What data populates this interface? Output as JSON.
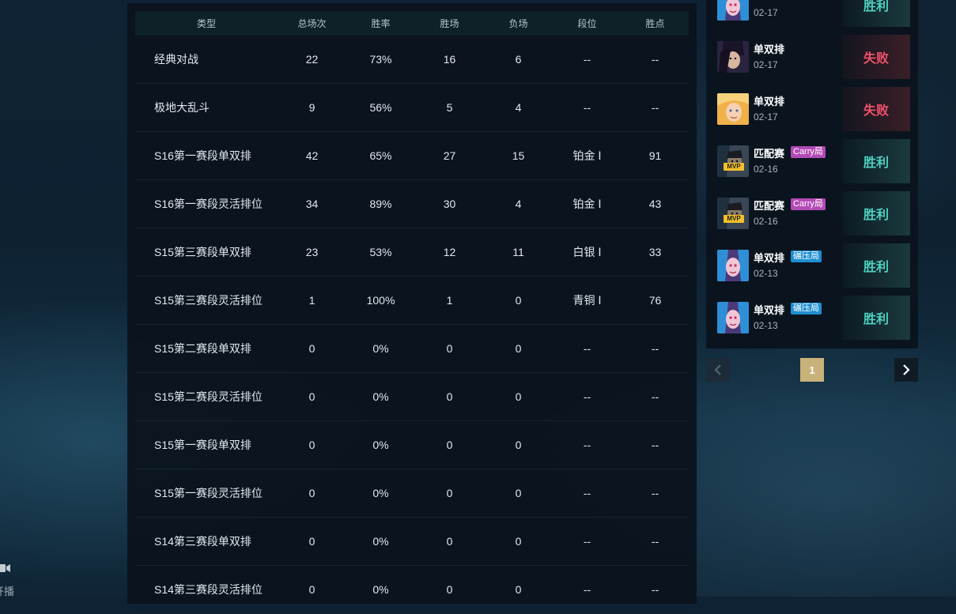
{
  "stats_table": {
    "headers": [
      "类型",
      "总场次",
      "胜率",
      "胜场",
      "负场",
      "段位",
      "胜点"
    ],
    "rows": [
      [
        "经典对战",
        "22",
        "73%",
        "16",
        "6",
        "--",
        "--"
      ],
      [
        "极地大乱斗",
        "9",
        "56%",
        "5",
        "4",
        "--",
        "--"
      ],
      [
        "S16第一赛段单双排",
        "42",
        "65%",
        "27",
        "15",
        "铂金 Ⅰ",
        "91"
      ],
      [
        "S16第一赛段灵活排位",
        "34",
        "89%",
        "30",
        "4",
        "铂金 Ⅰ",
        "43"
      ],
      [
        "S15第三赛段单双排",
        "23",
        "53%",
        "12",
        "11",
        "白银 Ⅰ",
        "33"
      ],
      [
        "S15第三赛段灵活排位",
        "1",
        "100%",
        "1",
        "0",
        "青铜 Ⅰ",
        "76"
      ],
      [
        "S15第二赛段单双排",
        "0",
        "0%",
        "0",
        "0",
        "--",
        "--"
      ],
      [
        "S15第二赛段灵活排位",
        "0",
        "0%",
        "0",
        "0",
        "--",
        "--"
      ],
      [
        "S15第一赛段单双排",
        "0",
        "0%",
        "0",
        "0",
        "--",
        "--"
      ],
      [
        "S15第一赛段灵活排位",
        "0",
        "0%",
        "0",
        "0",
        "--",
        "--"
      ],
      [
        "S14第三赛段单双排",
        "0",
        "0%",
        "0",
        "0",
        "--",
        "--"
      ],
      [
        "S14第三赛段灵活排位",
        "0",
        "0%",
        "0",
        "0",
        "--",
        "--"
      ]
    ]
  },
  "matches": [
    {
      "mode": "",
      "date": "02-17",
      "tag": "",
      "tag_type": "",
      "result": "胜利",
      "result_type": "win",
      "mvp": false,
      "champ": "jinx",
      "partial": true
    },
    {
      "mode": "单双排",
      "date": "02-17",
      "tag": "",
      "tag_type": "",
      "result": "失败",
      "result_type": "lose",
      "mvp": false,
      "champ": "yasuo"
    },
    {
      "mode": "单双排",
      "date": "02-17",
      "tag": "",
      "tag_type": "",
      "result": "失败",
      "result_type": "lose",
      "mvp": false,
      "champ": "blonde"
    },
    {
      "mode": "匹配赛",
      "date": "02-16",
      "tag": "Carry局",
      "tag_type": "carry",
      "result": "胜利",
      "result_type": "win",
      "mvp": true,
      "champ": "dark"
    },
    {
      "mode": "匹配赛",
      "date": "02-16",
      "tag": "Carry局",
      "tag_type": "carry",
      "result": "胜利",
      "result_type": "win",
      "mvp": true,
      "champ": "dark"
    },
    {
      "mode": "单双排",
      "date": "02-13",
      "tag": "碾压局",
      "tag_type": "crush",
      "result": "胜利",
      "result_type": "win",
      "mvp": false,
      "champ": "jinx"
    },
    {
      "mode": "单双排",
      "date": "02-13",
      "tag": "碾压局",
      "tag_type": "crush",
      "result": "胜利",
      "result_type": "win",
      "mvp": false,
      "champ": "jinx"
    }
  ],
  "mvp_label": "MVP",
  "pagination": {
    "current_page": "1"
  },
  "live": {
    "label": "开播"
  },
  "colors": {
    "win": "#4fd1c1",
    "lose": "#f0516a",
    "page_active": "#c8b27a",
    "carry_tag": "#b34ab5",
    "crush_tag": "#1f8fd1"
  }
}
